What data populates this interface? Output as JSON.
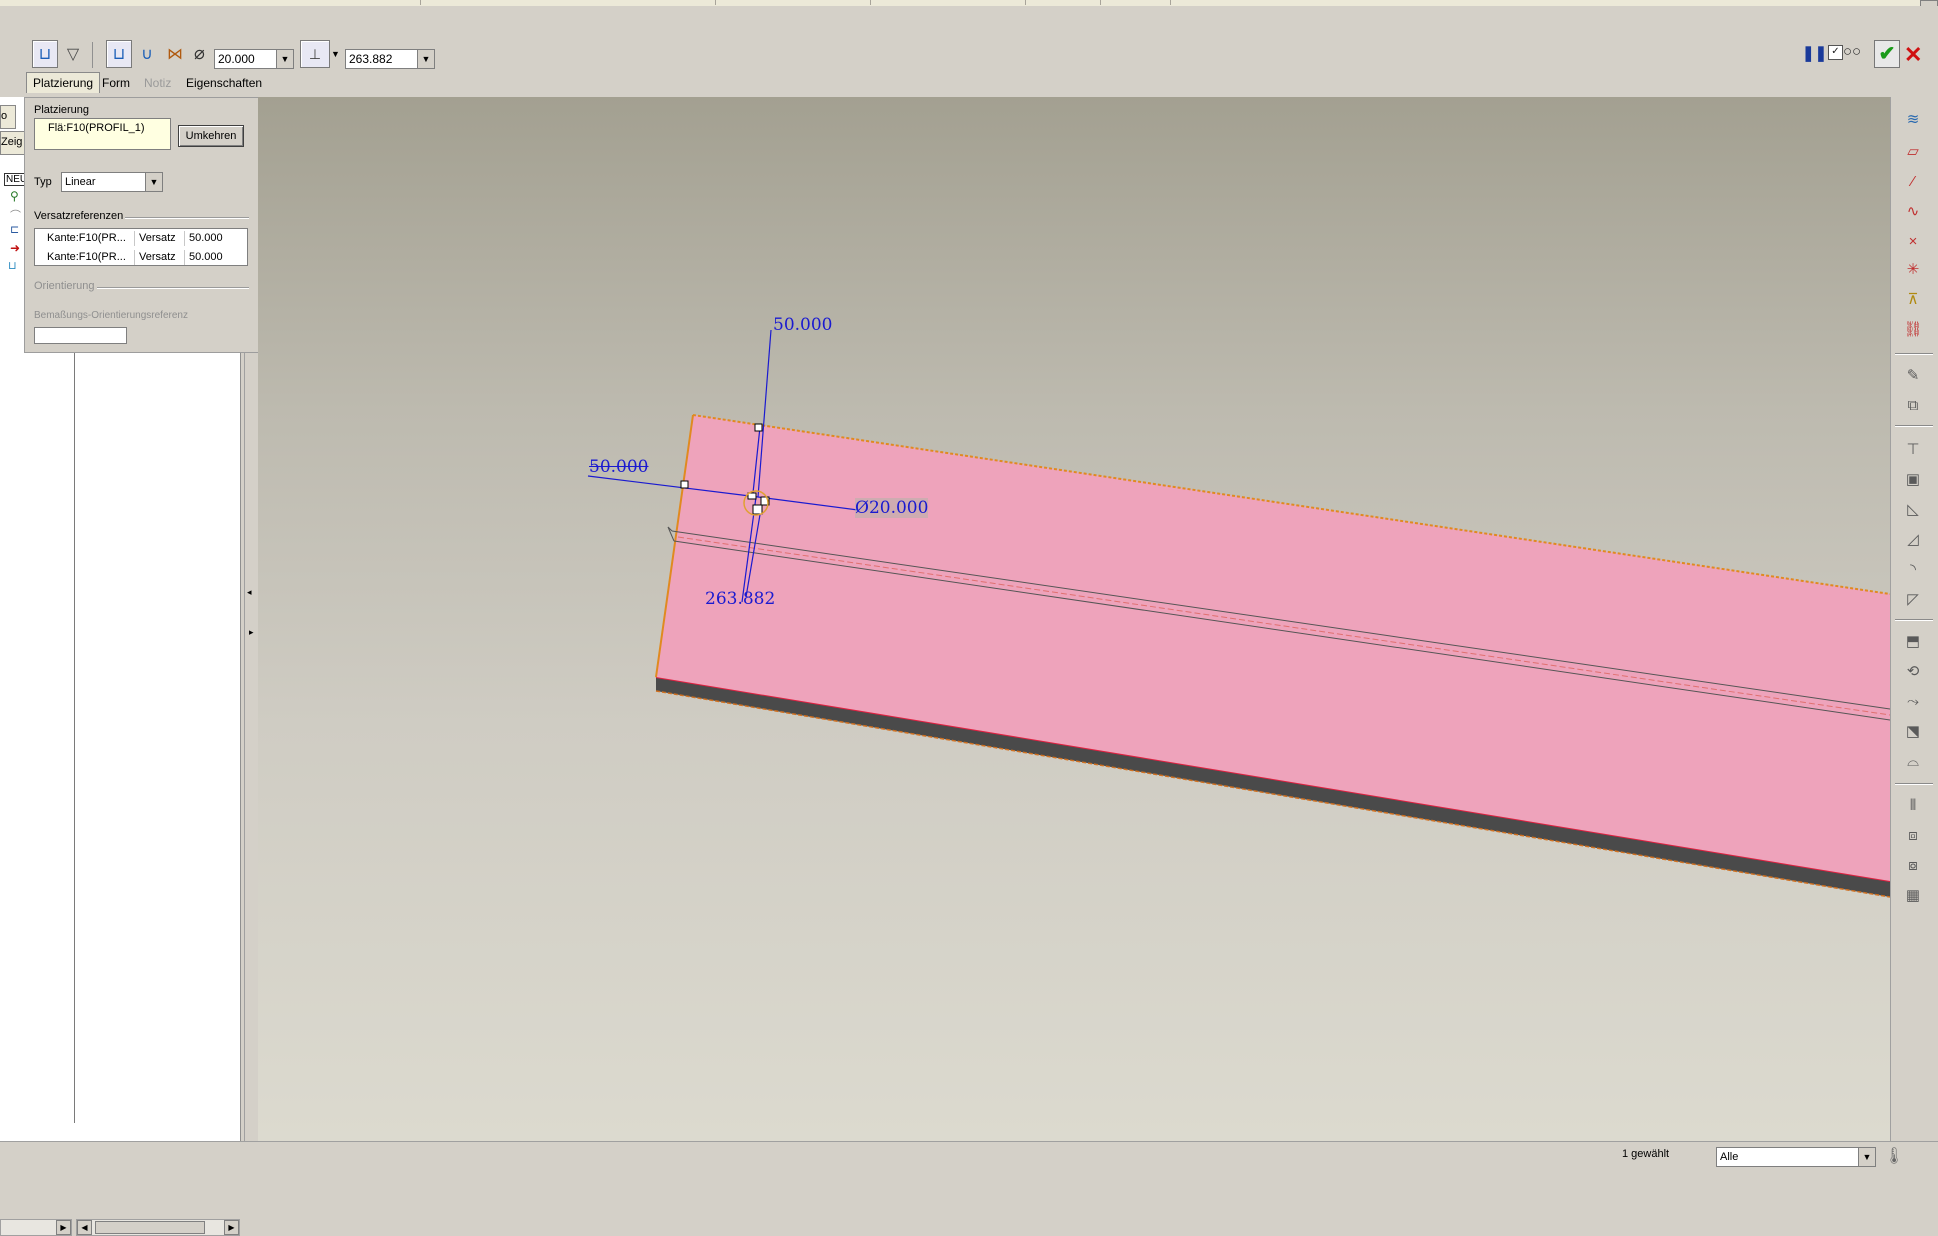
{
  "toolbar": {
    "diameter_value": "20.000",
    "depth_value": "263.882",
    "pause_icon": "pause-icon",
    "preview_icon": "glasses-icon",
    "apply_icon": "checkmark-icon",
    "cancel_icon": "x-icon"
  },
  "tabs": [
    {
      "label": "Platzierung",
      "state": "active"
    },
    {
      "label": "Form",
      "state": "normal"
    },
    {
      "label": "Notiz",
      "state": "disabled"
    },
    {
      "label": "Eigenschaften",
      "state": "normal"
    }
  ],
  "placement_panel": {
    "section_title": "Platzierung",
    "primary_reference": "Flä:F10(PROFIL_1)",
    "flip_button": "Umkehren",
    "type_label": "Typ",
    "type_value": "Linear",
    "offset_refs_title": "Versatzreferenzen",
    "offset_refs": [
      {
        "ref": "Kante:F10(PR...",
        "kind": "Versatz",
        "value": "50.000"
      },
      {
        "ref": "Kante:F10(PR...",
        "kind": "Versatz",
        "value": "50.000"
      }
    ],
    "orientation_title": "Orientierung",
    "dim_orientation_label": "Bemaßungs-Orientierungsreferenz",
    "dim_orientation_value": ""
  },
  "tree": {
    "tab_fragment_1": "o",
    "tab_fragment_2": "Zeig",
    "item_fragment": "NEU"
  },
  "viewport": {
    "dim_top": "50.000",
    "dim_left": "50.000",
    "dim_diameter": "20.000",
    "diameter_symbol": "Ø",
    "dim_depth": "263.882",
    "colors": {
      "part_face": "#eea3bb",
      "part_side": "#4a4a4a",
      "dimension": "#1a1ad0",
      "edge_highlight": "#e08a20"
    }
  },
  "status": {
    "selected_count": "1 gewählt",
    "filter_value": "Alle"
  }
}
